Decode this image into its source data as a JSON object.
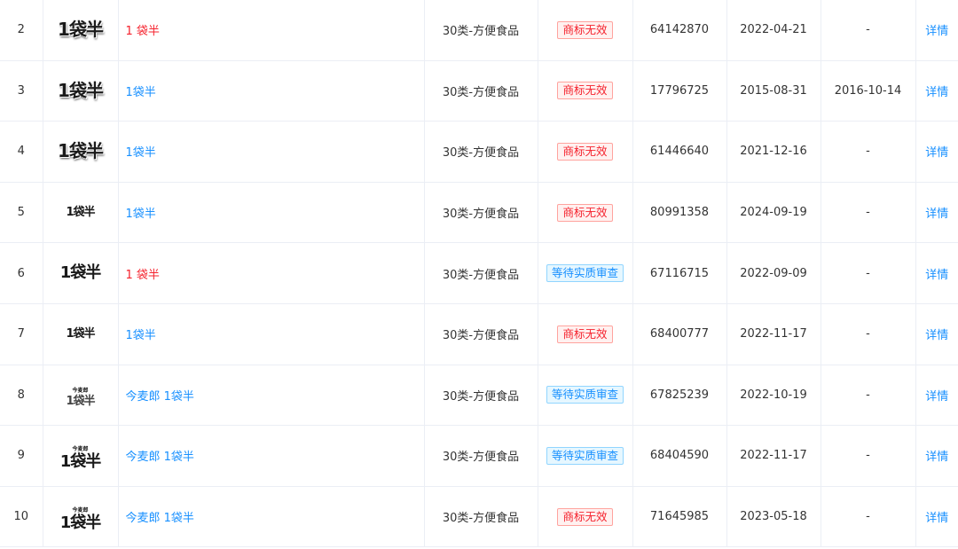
{
  "colors": {
    "link": "#1890ff",
    "alert_link": "#f5222d",
    "invalid_tag_text": "#f5222d",
    "invalid_tag_bg": "#fff1f0",
    "invalid_tag_border": "#ffa39e",
    "pending_tag_text": "#1890ff",
    "pending_tag_bg": "#e6f7ff",
    "pending_tag_border": "#91d5ff",
    "row_border": "#ebeef5"
  },
  "rows": [
    {
      "index": "2",
      "logo_text": "1袋半",
      "logo_sub": "",
      "logo_style": "big",
      "name": "1 袋半",
      "name_color": "red",
      "category": "30类-方便食品",
      "status": "商标无效",
      "status_type": "invalid",
      "reg_no": "64142870",
      "apply_date": "2022-04-21",
      "reg_date": "-",
      "action": "详情"
    },
    {
      "index": "3",
      "logo_text": "1袋半",
      "logo_sub": "",
      "logo_style": "big",
      "name": "1袋半",
      "name_color": "blue",
      "category": "30类-方便食品",
      "status": "商标无效",
      "status_type": "invalid",
      "reg_no": "17796725",
      "apply_date": "2015-08-31",
      "reg_date": "2016-10-14",
      "action": "详情"
    },
    {
      "index": "4",
      "logo_text": "1袋半",
      "logo_sub": "",
      "logo_style": "big",
      "name": "1袋半",
      "name_color": "blue",
      "category": "30类-方便食品",
      "status": "商标无效",
      "status_type": "invalid",
      "reg_no": "61446640",
      "apply_date": "2021-12-16",
      "reg_date": "-",
      "action": "详情"
    },
    {
      "index": "5",
      "logo_text": "1袋半",
      "logo_sub": "",
      "logo_style": "small",
      "name": "1袋半",
      "name_color": "blue",
      "category": "30类-方便食品",
      "status": "商标无效",
      "status_type": "invalid",
      "reg_no": "80991358",
      "apply_date": "2024-09-19",
      "reg_date": "-",
      "action": "详情"
    },
    {
      "index": "6",
      "logo_text": "1袋半",
      "logo_sub": "",
      "logo_style": "mid",
      "name": "1 袋半",
      "name_color": "red",
      "category": "30类-方便食品",
      "status": "等待实质审查",
      "status_type": "pending",
      "reg_no": "67116715",
      "apply_date": "2022-09-09",
      "reg_date": "-",
      "action": "详情"
    },
    {
      "index": "7",
      "logo_text": "1袋半",
      "logo_sub": "",
      "logo_style": "small",
      "name": "1袋半",
      "name_color": "blue",
      "category": "30类-方便食品",
      "status": "商标无效",
      "status_type": "invalid",
      "reg_no": "68400777",
      "apply_date": "2022-11-17",
      "reg_date": "-",
      "action": "详情"
    },
    {
      "index": "8",
      "logo_text": "1袋半",
      "logo_sub": "今麦郎",
      "logo_style": "gray",
      "name": "今麦郎 1袋半",
      "name_color": "blue",
      "category": "30类-方便食品",
      "status": "等待实质审查",
      "status_type": "pending",
      "reg_no": "67825239",
      "apply_date": "2022-10-19",
      "reg_date": "-",
      "action": "详情"
    },
    {
      "index": "9",
      "logo_text": "1袋半",
      "logo_sub": "今麦郎",
      "logo_style": "mid",
      "name": "今麦郎 1袋半",
      "name_color": "blue",
      "category": "30类-方便食品",
      "status": "等待实质审查",
      "status_type": "pending",
      "reg_no": "68404590",
      "apply_date": "2022-11-17",
      "reg_date": "-",
      "action": "详情"
    },
    {
      "index": "10",
      "logo_text": "1袋半",
      "logo_sub": "今麦郎",
      "logo_style": "mid",
      "name": "今麦郎 1袋半",
      "name_color": "blue",
      "category": "30类-方便食品",
      "status": "商标无效",
      "status_type": "invalid",
      "reg_no": "71645985",
      "apply_date": "2023-05-18",
      "reg_date": "-",
      "action": "详情"
    }
  ]
}
